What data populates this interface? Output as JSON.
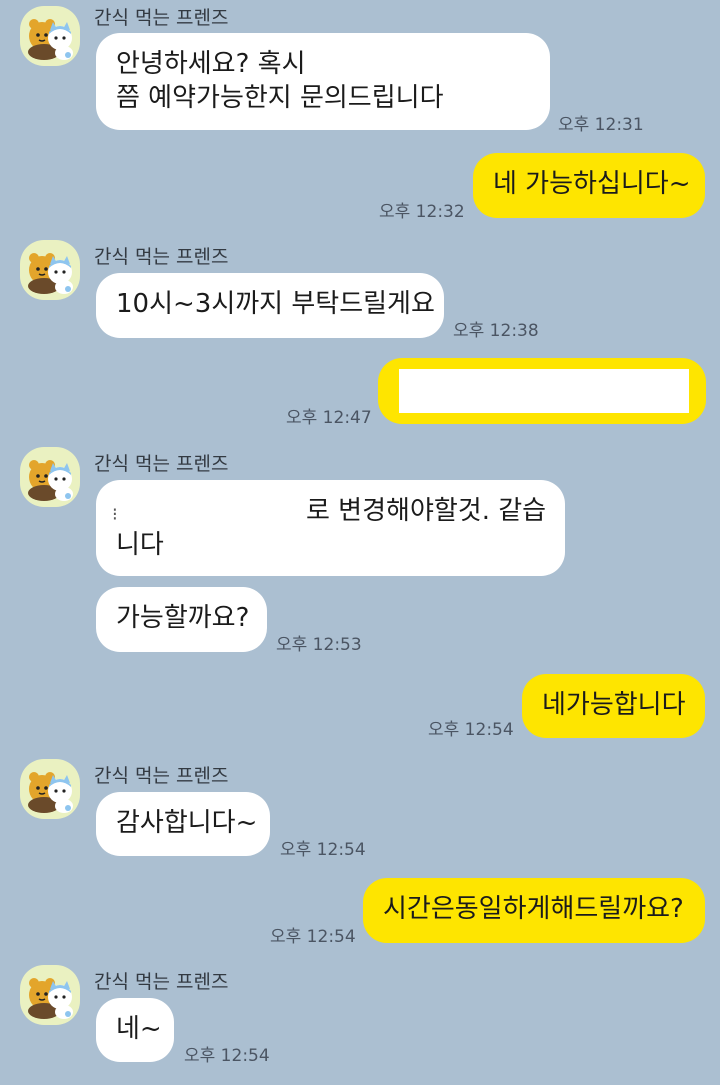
{
  "sender_name": "간식 먹는 프렌즈",
  "avatar_icon": "friends-characters-avatar",
  "colors": {
    "background": "#abbfd1",
    "incoming_bubble": "#ffffff",
    "outgoing_bubble": "#fee500"
  },
  "messages": [
    {
      "from": "friend",
      "lines": [
        "안녕하세요? 혹시",
        "쯤 예약가능한지 문의드립니다"
      ],
      "time": "오후 12:31"
    },
    {
      "from": "me",
      "lines": [
        "네 가능하십니다~"
      ],
      "time": "오후 12:32"
    },
    {
      "from": "friend",
      "lines": [
        "10시~3시까지 부탁드릴게요"
      ],
      "time": "오후 12:38"
    },
    {
      "from": "me",
      "lines": [],
      "redacted": true,
      "time": "오후 12:47"
    },
    {
      "from": "friend",
      "lines": [
        "로 변경해야할것. 같습",
        "니다"
      ],
      "time": ""
    },
    {
      "from": "friend",
      "lines": [
        "가능할까요?"
      ],
      "time": "오후 12:53"
    },
    {
      "from": "me",
      "lines": [
        "네가능합니다"
      ],
      "time": "오후 12:54"
    },
    {
      "from": "friend",
      "lines": [
        "감사합니다~"
      ],
      "time": "오후 12:54"
    },
    {
      "from": "me",
      "lines": [
        "시간은동일하게해드릴까요?"
      ],
      "time": "오후 12:54"
    },
    {
      "from": "friend",
      "lines": [
        "네~"
      ],
      "time": "오후 12:54"
    }
  ]
}
